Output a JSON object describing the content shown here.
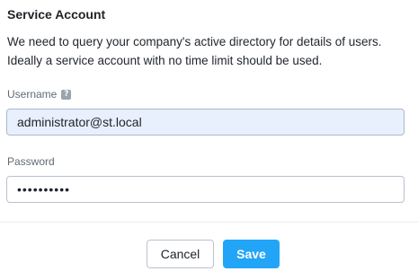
{
  "section": {
    "title": "Service Account",
    "description_line1": "We need to query your company's active directory for details of users.",
    "description_line2": "Ideally a service account with no time limit should be used."
  },
  "username": {
    "label": "Username",
    "help_icon": "question-mark-icon",
    "value": "administrator@st.local"
  },
  "password": {
    "label": "Password",
    "value": "••••••••••"
  },
  "actions": {
    "cancel_label": "Cancel",
    "save_label": "Save"
  },
  "colors": {
    "primary": "#22a5f7",
    "autofill_bg": "#e8f0fe",
    "border": "#b9c2cc"
  }
}
